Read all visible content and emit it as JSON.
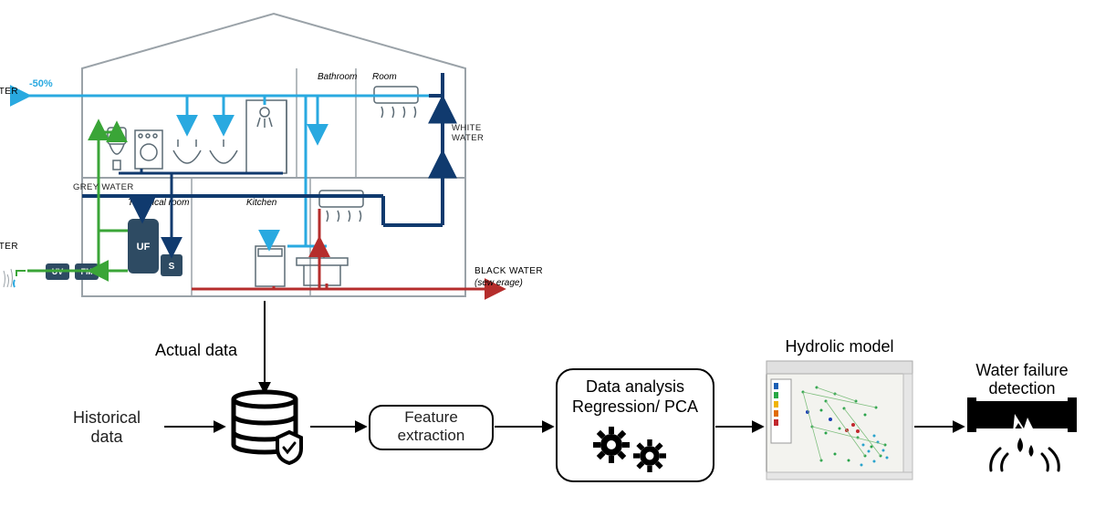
{
  "house": {
    "drinking_water": "DRINKING WATER",
    "drinking_reduction": "-50%",
    "grey_water": "GREY WATER",
    "white_water": "WHITE WATER",
    "treated_water": "TREATED WATER",
    "black_water": "BLACK WATER",
    "black_water_sub": "(sew erage)",
    "room_bathroom": "Bathroom",
    "room_room": "Room",
    "room_technical": "Technical room",
    "room_kitchen": "Kitchen",
    "box_uf": "UF",
    "box_s": "S",
    "box_uv": "UV",
    "box_fm": "FM"
  },
  "pipeline": {
    "actual_data": "Actual data",
    "historical_data": "Historical data",
    "feature_extraction": "Feature extraction",
    "data_analysis_l1": "Data analysis",
    "data_analysis_l2": "Regression/ PCA",
    "hydrolic_model": "Hydrolic model",
    "water_failure_l1": "Water failure",
    "water_failure_l2": "detection"
  }
}
